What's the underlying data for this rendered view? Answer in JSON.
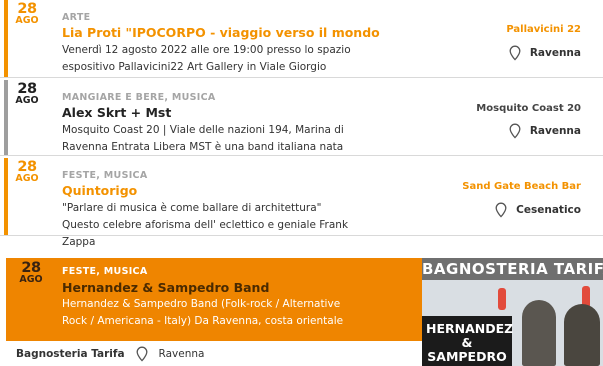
{
  "events": [
    {
      "day": "28",
      "month": "AGO",
      "category": "ARTE",
      "title": "Lia Proti \"IPOCORPO - viaggio verso il mondo",
      "description": "Venerdì 12 agosto 2022 alle ore 19:00 presso lo spazio espositivo Pallavicini22 Art Gallery in Viale Giorgio",
      "venue": "Pallavicini 22",
      "city": "Ravenna",
      "theme": "orange"
    },
    {
      "day": "28",
      "month": "AGO",
      "category": "MANGIARE E BERE, MUSICA",
      "title": "Alex Skrt + Mst",
      "description": "Mosquito Coast 20 | Viale delle nazioni 194, Marina di Ravenna  Entrata Libera MST è una band italiana nata",
      "venue": "Mosquito Coast 20",
      "city": "Ravenna",
      "theme": "dark"
    },
    {
      "day": "28",
      "month": "AGO",
      "category": "FESTE, MUSICA",
      "title": "Quintorigo",
      "description": "\"Parlare di musica è come ballare di architettura\" Questo celebre aforisma dell' eclettico e geniale Frank Zappa",
      "venue": "Sand Gate Beach Bar",
      "city": "Cesenatico",
      "theme": "orange"
    }
  ],
  "featured": {
    "day": "28",
    "month": "AGO",
    "category": "FESTE, MUSICA",
    "title": "Hernandez & Sampedro Band",
    "description": "Hernandez & Sampedro Band (Folk-rock / Alternative Rock / Americana - Italy) Da Ravenna, costa orientale",
    "venue": "Bagnosteria Tarifa",
    "city": "Ravenna",
    "poster": {
      "brand": "BAGNOSTERIA TARIFA",
      "band_line1": "HERNANDEZ &",
      "band_line2": "SAMPEDRO"
    }
  },
  "colors": {
    "orange": "#f39200",
    "featured_bg": "#ef8500",
    "gray": "#a5a5a5"
  }
}
